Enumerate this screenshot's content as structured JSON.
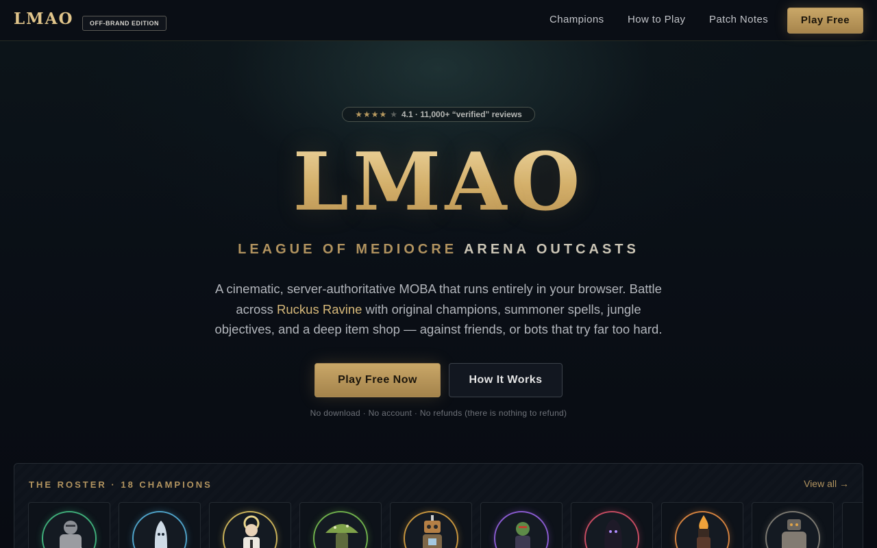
{
  "header": {
    "brand": "LMAO",
    "edition_badge": "OFF-BRAND EDITION",
    "nav": [
      "Champions",
      "How to Play",
      "Patch Notes"
    ],
    "cta": "Play Free"
  },
  "hero": {
    "rating_stars": "★★★★",
    "rating_star_off": "★",
    "rating_text": "4.1 · 11,000+ “verified” reviews",
    "title": "LMAO",
    "tagline_part1": "LEAGUE OF MEDIOCRE ",
    "tagline_part2": "ARENA OUTCASTS",
    "desc_before": "A cinematic, server-authoritative MOBA that runs entirely in your browser. Battle across ",
    "desc_highlight": "Ruckus Ravine",
    "desc_after": " with original champions, summoner spells, jungle objectives, and a deep item shop — against friends, or bots that try far too hard.",
    "primary_cta": "Play Free Now",
    "secondary_cta": "How It Works",
    "fineprint": "No download · No account · No refunds (there is nothing to refund)"
  },
  "roster": {
    "heading": "THE ROSTER · 18 CHAMPIONS",
    "view_all": "View all →",
    "champions": [
      {
        "icon": "armored-knight-icon",
        "ring": "#3fae7a"
      },
      {
        "icon": "ghost-icon",
        "ring": "#4fa3c9"
      },
      {
        "icon": "haloed-priest-icon",
        "ring": "#cbb35a"
      },
      {
        "icon": "mushroom-icon",
        "ring": "#6fb04c"
      },
      {
        "icon": "robot-icon",
        "ring": "#c8963e"
      },
      {
        "icon": "goblin-icon",
        "ring": "#8a5bd0"
      },
      {
        "icon": "shadow-figure-icon",
        "ring": "#c74c62"
      },
      {
        "icon": "flame-head-icon",
        "ring": "#d4823f"
      },
      {
        "icon": "golem-icon",
        "ring": "#7d7a72"
      }
    ]
  }
}
